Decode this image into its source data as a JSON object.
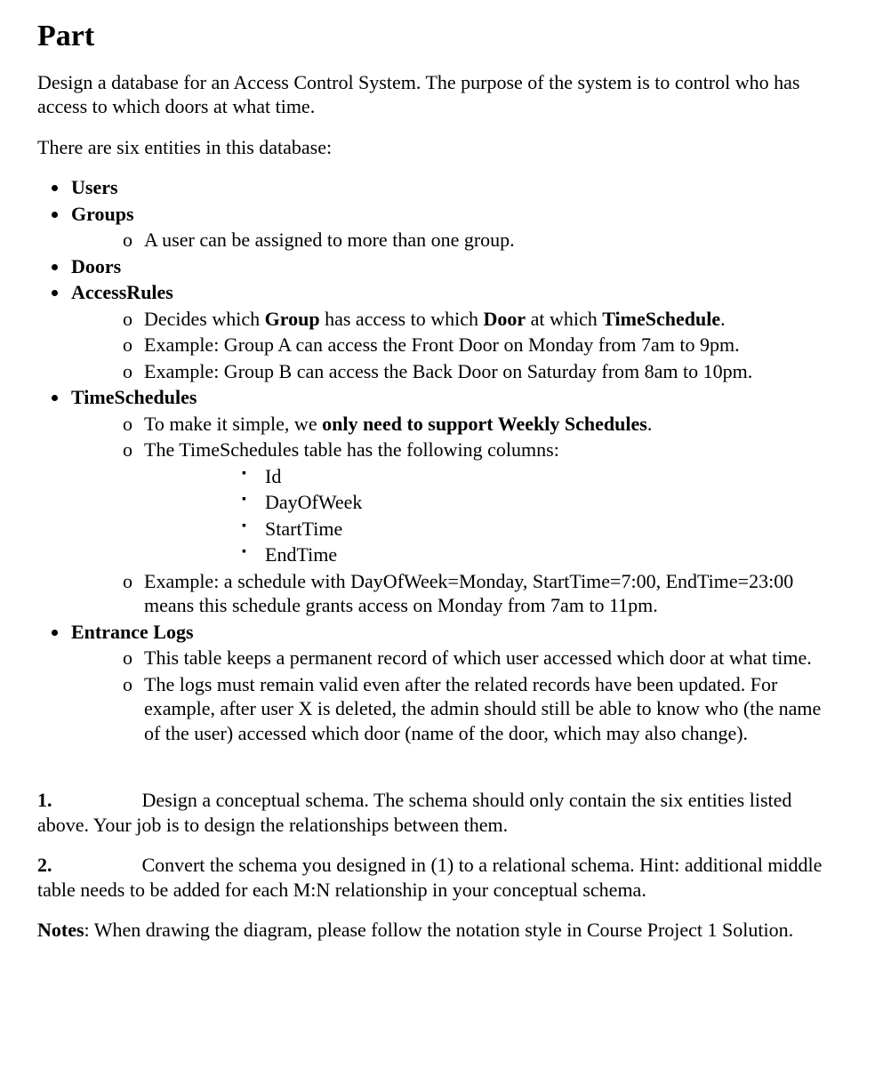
{
  "title": "Part",
  "intro1": "Design a database for an Access Control System. The purpose of the system is to control who has access to which doors at what time.",
  "intro2": "There are six entities in this database:",
  "entities": {
    "users": "Users",
    "groups": "Groups",
    "groups_sub1": "A user can be assigned to more than one group.",
    "doors": "Doors",
    "accessRules": "AccessRules",
    "ar_sub1_pre": "Decides which ",
    "ar_sub1_g": "Group",
    "ar_sub1_mid1": " has access to which ",
    "ar_sub1_d": "Door",
    "ar_sub1_mid2": " at which ",
    "ar_sub1_ts": "TimeSchedule",
    "ar_sub1_post": ".",
    "ar_sub2": "Example: Group A can access the Front Door on Monday from 7am to 9pm.",
    "ar_sub3": "Example: Group B can access the Back Door on Saturday from 8am to 10pm.",
    "timeSchedules": "TimeSchedules",
    "ts_sub1_pre": "To make it simple, we ",
    "ts_sub1_bold": "only need to support Weekly Schedules",
    "ts_sub1_post": ".",
    "ts_sub2": "The TimeSchedules table has the following columns:",
    "ts_cols": {
      "c1": "Id",
      "c2": "DayOfWeek",
      "c3": "StartTime",
      "c4": "EndTime"
    },
    "ts_sub3": "Example: a schedule with DayOfWeek=Monday, StartTime=7:00, EndTime=23:00 means this schedule grants access on Monday from 7am to 11pm.",
    "entranceLogs": "Entrance Logs",
    "el_sub1": "This table keeps a permanent record of which user accessed which door at what time.",
    "el_sub2": "The logs must remain valid even after the related records have been updated. For example, after user X is deleted, the admin should still be able to know who (the name of the user) accessed which door (name of the door, which may also change)."
  },
  "task1_num": "1.",
  "task1_text": "Design a conceptual schema. The schema should only contain the six entities listed above. Your job is to design the relationships between them.",
  "task2_num": "2.",
  "task2_text": "Convert the schema you designed in (1) to a relational schema. Hint: additional middle table needs to be added for each M:N relationship in your conceptual schema.",
  "notes_label": "Notes",
  "notes_text": ": When drawing the diagram, please follow the notation style in Course Project 1 Solution."
}
